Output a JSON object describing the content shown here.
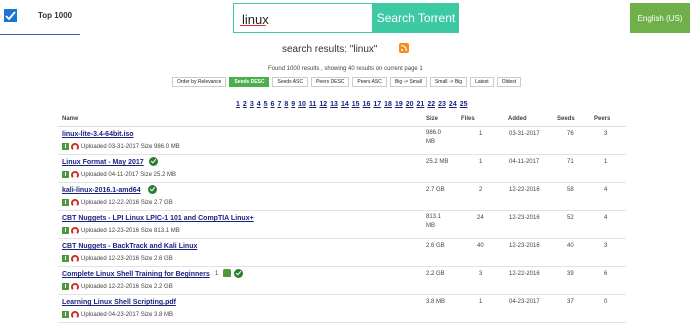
{
  "header": {
    "brand": "Top 1000",
    "search_value": "linux",
    "search_button": "Search Torrent",
    "language_button": "English (US)"
  },
  "results": {
    "title": "search results: \"linux\"",
    "found_text": "Found 1000 results , showing 40 results on current page 1"
  },
  "sort_buttons": [
    "Order by Relevance",
    "Seeds DESC",
    "Seeds ASC",
    "Peers DESC",
    "Peers ASC",
    "Big -> Small",
    "Small -> Big",
    "Latest",
    "Oldest"
  ],
  "active_sort": "Seeds DESC",
  "pagination": [
    "1",
    "2",
    "3",
    "4",
    "5",
    "6",
    "7",
    "8",
    "9",
    "10",
    "11",
    "12",
    "13",
    "14",
    "15",
    "16",
    "17",
    "18",
    "19",
    "20",
    "21",
    "22",
    "23",
    "24",
    "25"
  ],
  "table": {
    "headers": {
      "name": "Name",
      "size": "Size",
      "files": "Files",
      "added": "Added",
      "seeds": "Seeds",
      "peers": "Peers"
    },
    "rows": [
      {
        "title": "linux-lite-3.4-64bit.iso",
        "uploaded": "Uploaded 03-31-2017 Size 986.0 MB",
        "size": "986.0 MB",
        "files": "1",
        "added": "03-31-2017",
        "seeds": "76",
        "peers": "3",
        "verified": false
      },
      {
        "title": "Linux Format - May 2017",
        "uploaded": "Uploaded 04-11-2017 Size 25.2 MB",
        "size": "25.2 MB",
        "files": "1",
        "added": "04-11-2017",
        "seeds": "71",
        "peers": "1",
        "verified": true
      },
      {
        "title": "kali-linux-2016.1-amd64",
        "uploaded": "Uploaded 12-22-2016 Size 2.7 GB",
        "size": "2.7 GB",
        "files": "2",
        "added": "12-22-2016",
        "seeds": "58",
        "peers": "4",
        "verified": true
      },
      {
        "title": "CBT Nuggets - LPI Linux LPIC-1 101 and CompTIA Linux+",
        "uploaded": "Uploaded 12-23-2016 Size 813.1 MB",
        "size": "813.1 MB",
        "files": "24",
        "added": "12-23-2016",
        "seeds": "52",
        "peers": "4",
        "verified": false
      },
      {
        "title": "CBT Nuggets - BackTrack and Kali Linux",
        "uploaded": "Uploaded 12-23-2016 Size 2.6 GB",
        "size": "2.6 GB",
        "files": "40",
        "added": "12-23-2016",
        "seeds": "40",
        "peers": "3",
        "verified": false
      },
      {
        "title": "Complete Linux Shell Training for Beginners",
        "uploaded": "Uploaded 12-22-2016 Size 2.2 GB",
        "size": "2.2 GB",
        "files": "3",
        "added": "12-22-2016",
        "seeds": "39",
        "peers": "6",
        "verified": true,
        "likes": "1"
      },
      {
        "title": "Learning Linux Shell Scripting.pdf",
        "uploaded": "Uploaded 04-23-2017 Size 3.8 MB",
        "size": "3.8 MB",
        "files": "1",
        "added": "04-23-2017",
        "seeds": "37",
        "peers": "0",
        "verified": false
      }
    ]
  }
}
